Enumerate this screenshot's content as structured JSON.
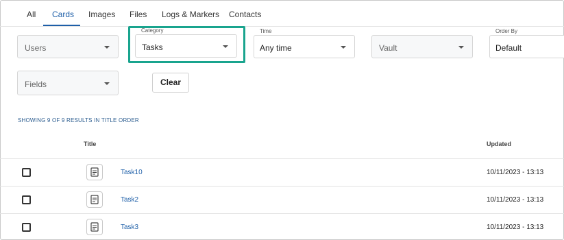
{
  "tabs": [
    "All",
    "Cards",
    "Images",
    "Files",
    "Logs & Markers",
    "Contacts"
  ],
  "filters": {
    "users": {
      "value": "Users"
    },
    "category": {
      "label": "Category",
      "value": "Tasks"
    },
    "time": {
      "label": "Time",
      "value": "Any time"
    },
    "vault": {
      "value": "Vault"
    },
    "order_by": {
      "label": "Order By",
      "value": "Default"
    },
    "fields": {
      "value": "Fields"
    }
  },
  "clear_label": "Clear",
  "summary": "SHOWING 9 OF 9 RESULTS IN TITLE ORDER",
  "table": {
    "headers": {
      "title": "Title",
      "updated": "Updated"
    },
    "rows": [
      {
        "title": "Task10",
        "updated": "10/11/2023 - 13:13"
      },
      {
        "title": "Task2",
        "updated": "10/11/2023 - 13:13"
      },
      {
        "title": "Task3",
        "updated": "10/11/2023 - 13:13"
      }
    ]
  },
  "colors": {
    "accent": "#1e5fa8",
    "highlight": "#19a48e"
  }
}
